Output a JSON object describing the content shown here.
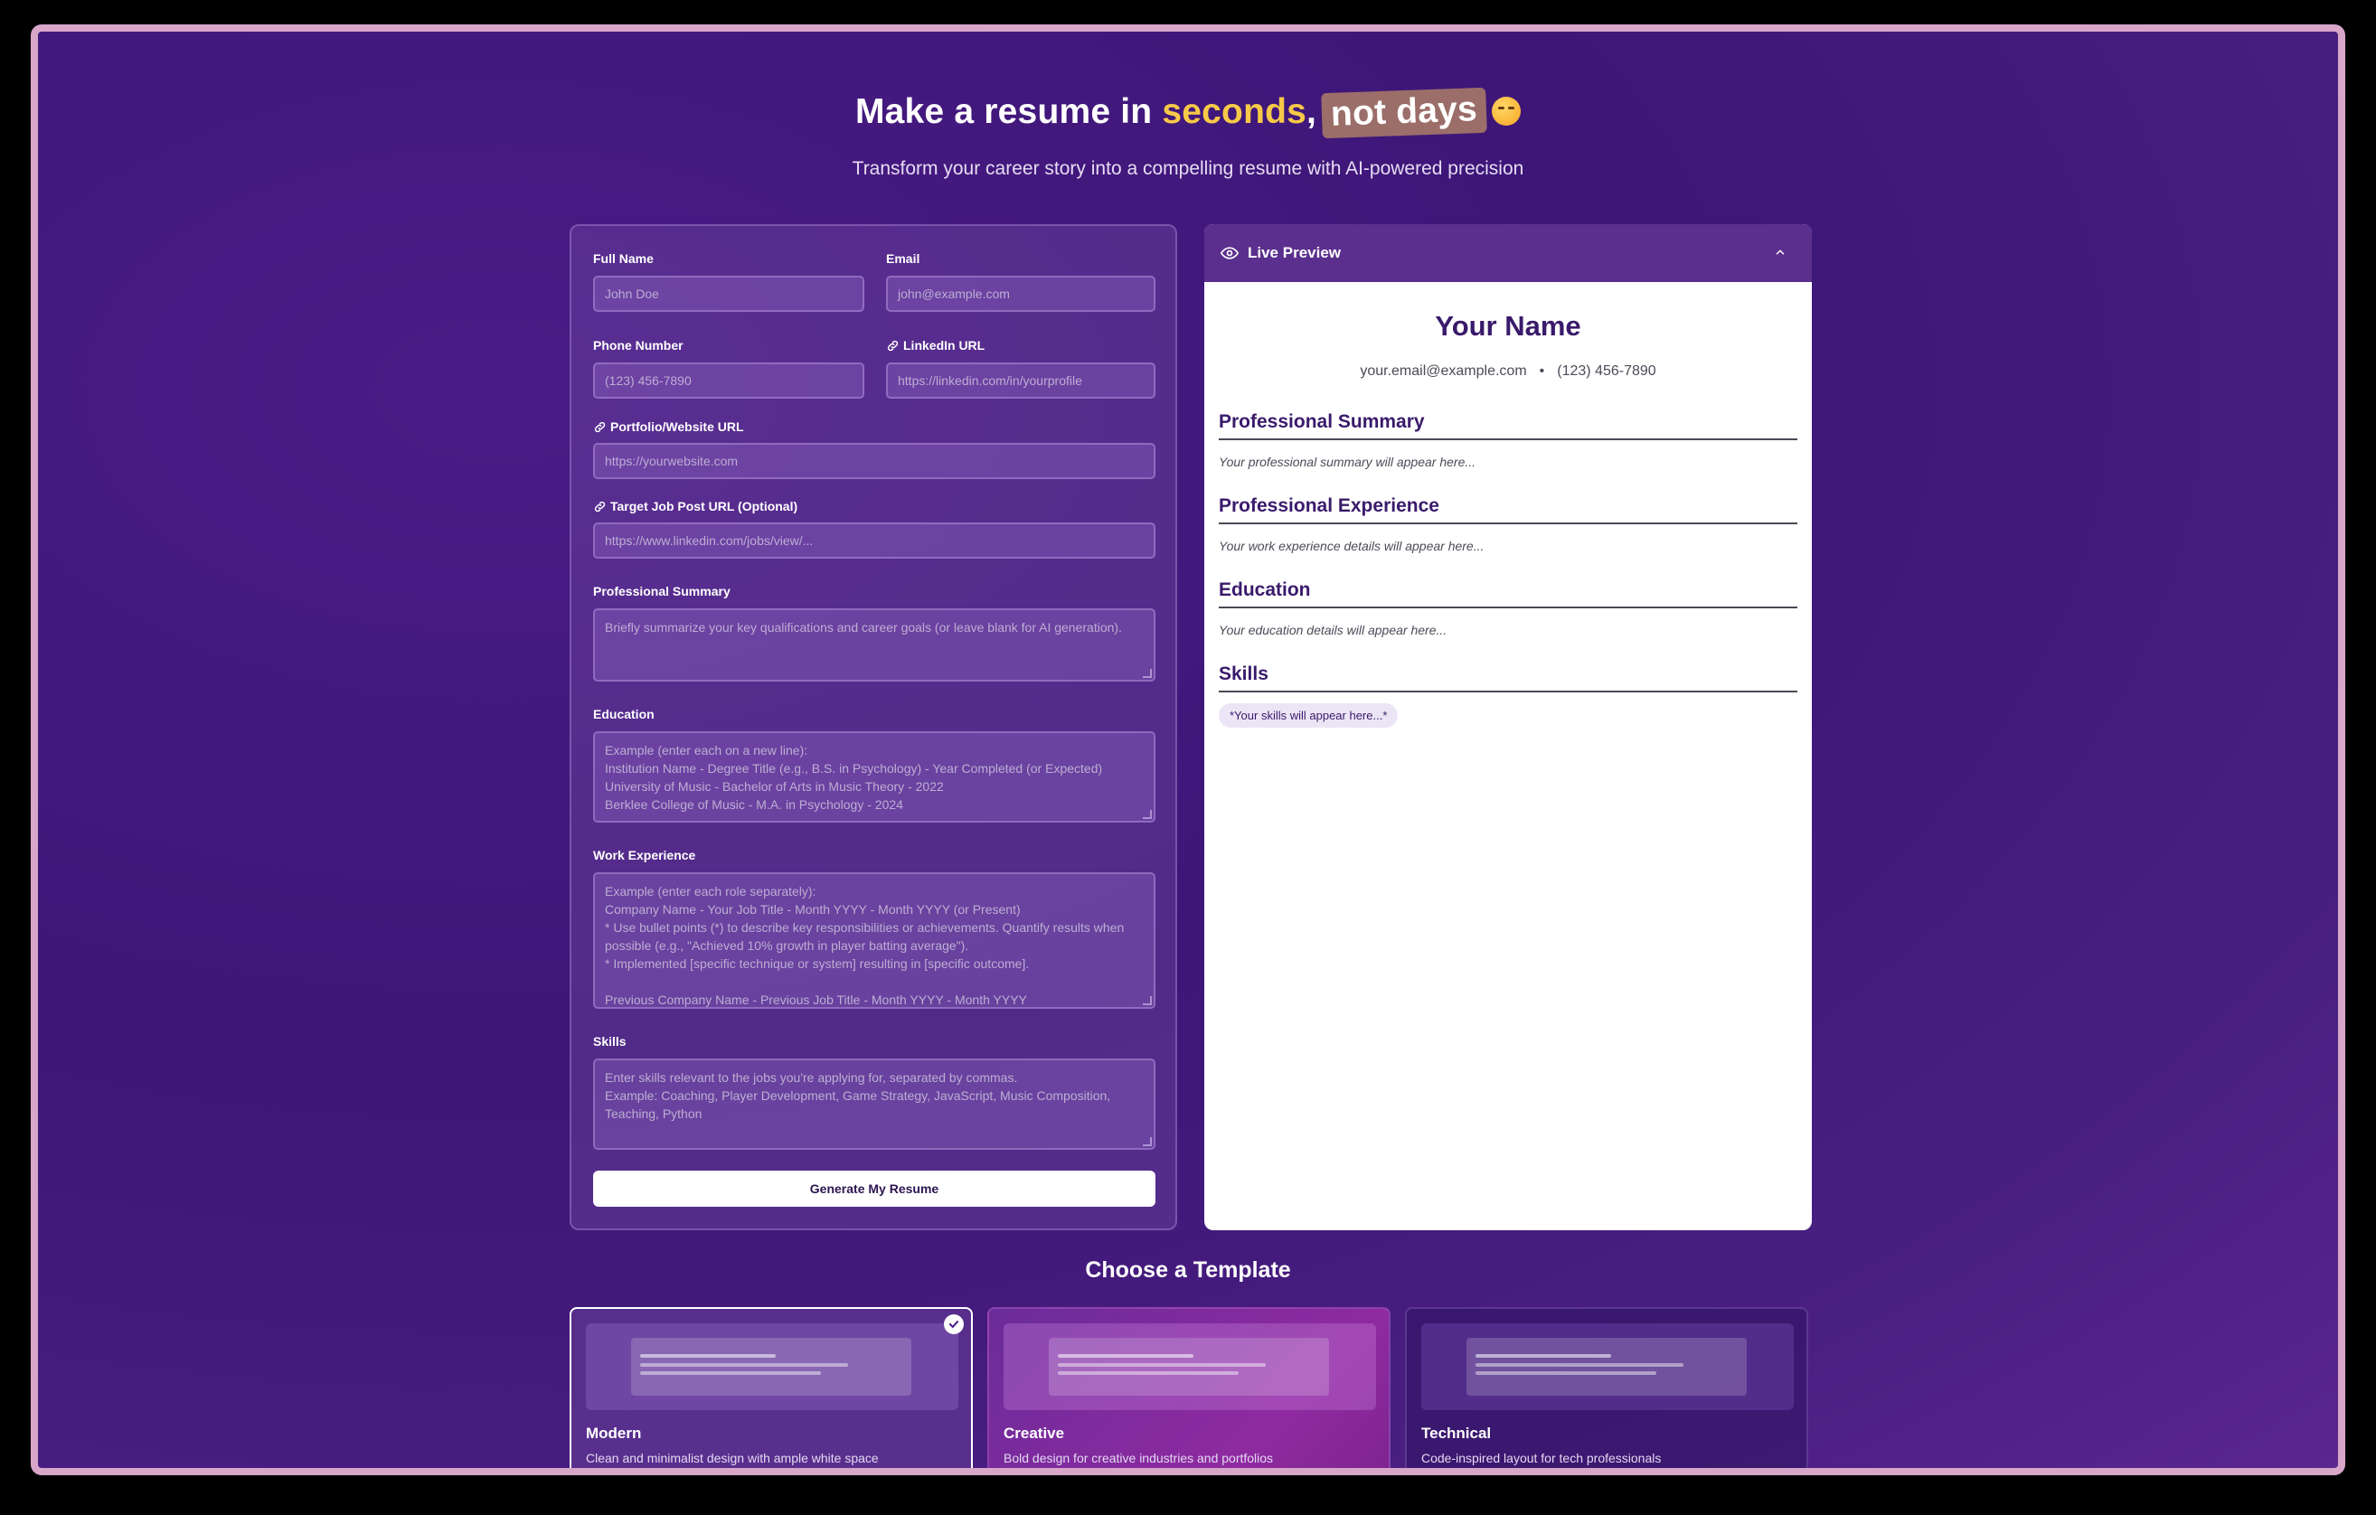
{
  "hero": {
    "title_part1": "Make a resume in ",
    "title_highlight": "seconds",
    "title_comma": ",",
    "title_pill": "not days",
    "subtitle": "Transform your career story into a compelling resume with AI-powered precision"
  },
  "form": {
    "full_name": {
      "label": "Full Name",
      "placeholder": "John Doe"
    },
    "email": {
      "label": "Email",
      "placeholder": "john@example.com"
    },
    "phone": {
      "label": "Phone Number",
      "placeholder": "(123) 456-7890"
    },
    "linkedin": {
      "label": "LinkedIn URL",
      "placeholder": "https://linkedin.com/in/yourprofile"
    },
    "portfolio": {
      "label": "Portfolio/Website URL",
      "placeholder": "https://yourwebsite.com"
    },
    "job_post": {
      "label": "Target Job Post URL (Optional)",
      "placeholder": "https://www.linkedin.com/jobs/view/..."
    },
    "summary": {
      "label": "Professional Summary",
      "placeholder": "Briefly summarize your key qualifications and career goals (or leave blank for AI generation)."
    },
    "education": {
      "label": "Education",
      "placeholder": "Example (enter each on a new line):\nInstitution Name - Degree Title (e.g., B.S. in Psychology) - Year Completed (or Expected)\nUniversity of Music - Bachelor of Arts in Music Theory - 2022\nBerklee College of Music - M.A. in Psychology - 2024"
    },
    "experience": {
      "label": "Work Experience",
      "placeholder": "Example (enter each role separately):\nCompany Name - Your Job Title - Month YYYY - Month YYYY (or Present)\n* Use bullet points (*) to describe key responsibilities or achievements. Quantify results when possible (e.g., \"Achieved 10% growth in player batting average\").\n* Implemented [specific technique or system] resulting in [specific outcome].\n\nPrevious Company Name - Previous Job Title - Month YYYY - Month YYYY"
    },
    "skills": {
      "label": "Skills",
      "placeholder": "Enter skills relevant to the jobs you're applying for, separated by commas.\nExample: Coaching, Player Development, Game Strategy, JavaScript, Music Composition, Teaching, Python"
    },
    "generate_label": "Generate My Resume"
  },
  "preview": {
    "header": "Live Preview",
    "name": "Your Name",
    "email": "your.email@example.com",
    "separator": "•",
    "phone": "(123) 456-7890",
    "sections": {
      "summary": {
        "title": "Professional Summary",
        "placeholder": "Your professional summary will appear here..."
      },
      "experience": {
        "title": "Professional Experience",
        "placeholder": "Your work experience details will appear here..."
      },
      "education": {
        "title": "Education",
        "placeholder": "Your education details will appear here..."
      },
      "skills": {
        "title": "Skills",
        "chip": "*Your skills will appear here...*"
      }
    }
  },
  "templates": {
    "title": "Choose a Template",
    "items": [
      {
        "name": "Modern",
        "description": "Clean and minimalist design with ample white space",
        "selected": true
      },
      {
        "name": "Creative",
        "description": "Bold design for creative industries and portfolios",
        "selected": false
      },
      {
        "name": "Technical",
        "description": "Code-inspired layout for tech professionals",
        "selected": false
      }
    ]
  },
  "colors": {
    "background": "#3d1677",
    "accent_yellow": "#f7c948",
    "pill_brown": "#9b6e6a",
    "preview_header": "#5b2f8e",
    "heading_purple": "#3a1a6b"
  }
}
